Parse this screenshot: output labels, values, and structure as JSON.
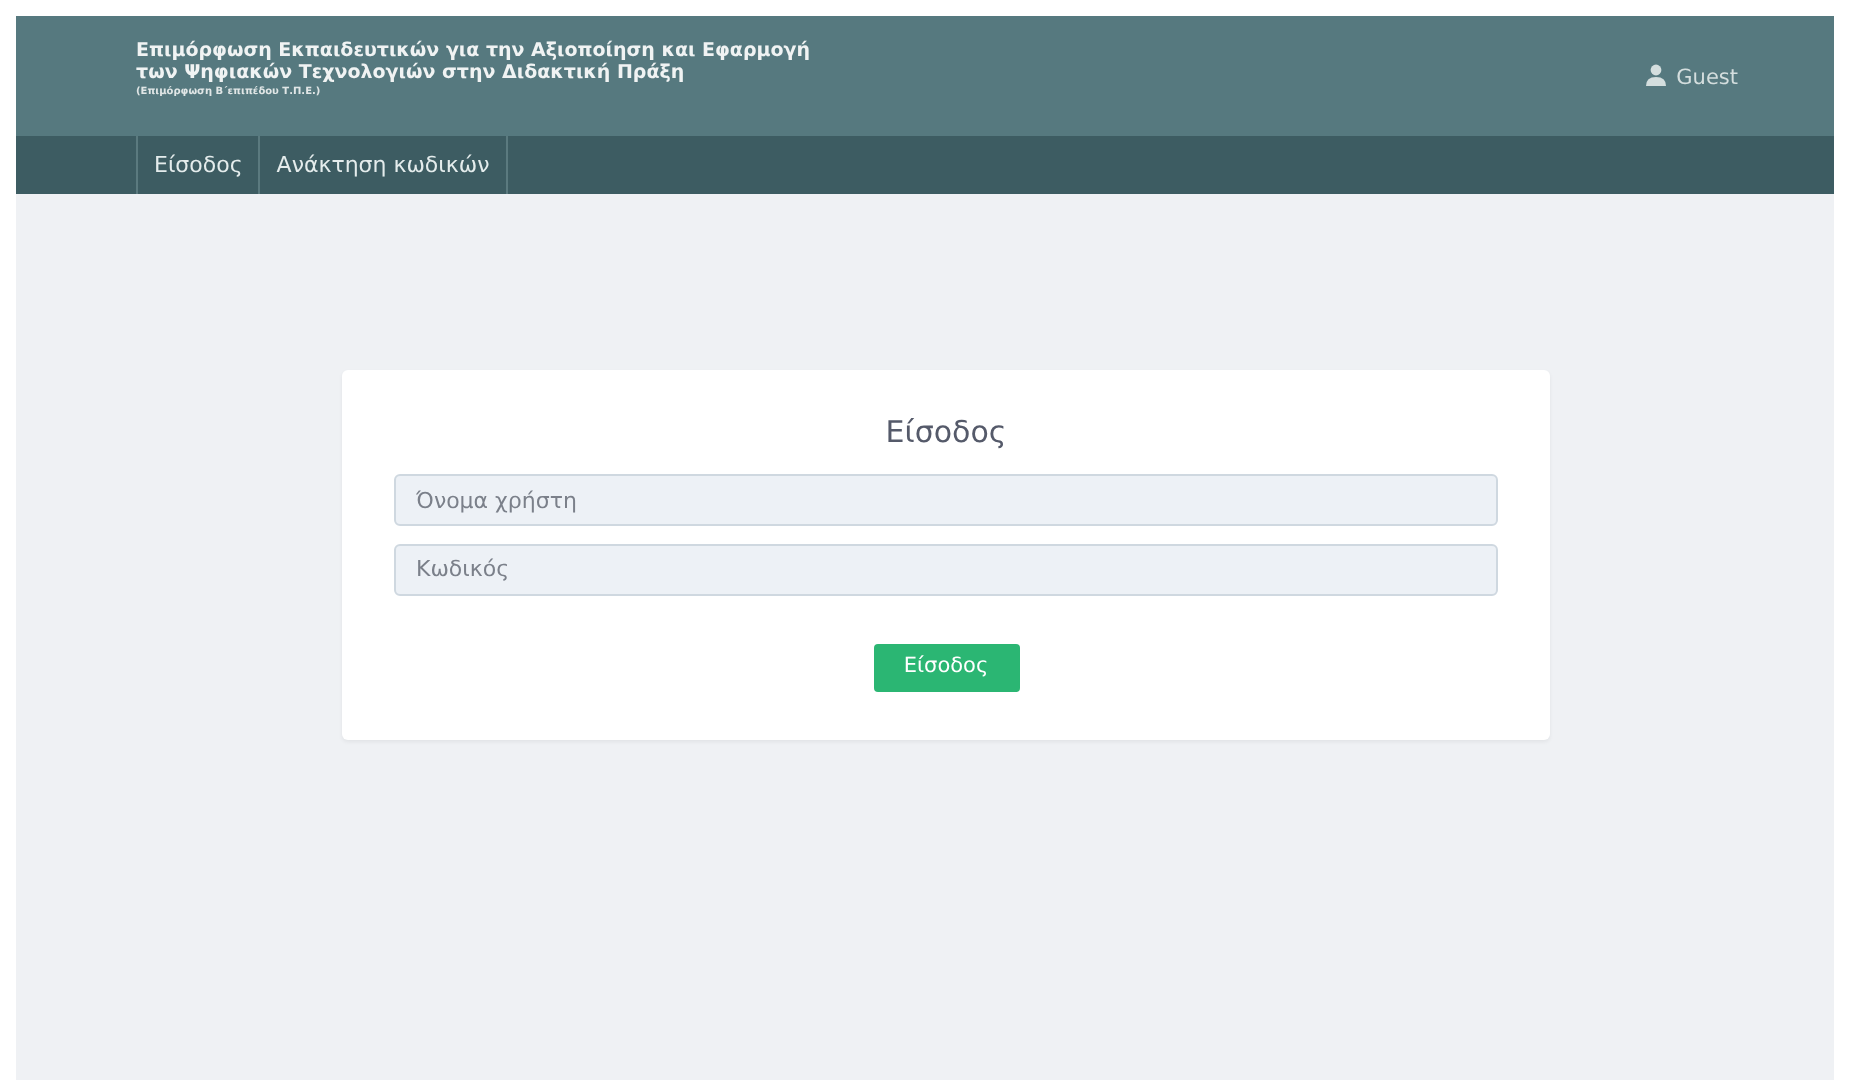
{
  "header": {
    "title_line_1": "Επιμόρφωση Εκπαιδευτικών για την Αξιοποίηση και Εφαρμογή",
    "title_line_2": "των Ψηφιακών Τεχνολογιών στην Διδακτική Πράξη",
    "subtitle": "(Επιμόρφωση Β΄επιπέδου Τ.Π.Ε.)",
    "user": "Guest"
  },
  "nav": [
    {
      "label": "Είσοδος"
    },
    {
      "label": "Ανάκτηση κωδικών"
    }
  ],
  "login": {
    "title": "Είσοδος",
    "fields": [
      {
        "placeholder": "Όνομα χρήστη"
      },
      {
        "placeholder": "Κωδικός"
      }
    ],
    "button": "Είσοδος"
  }
}
